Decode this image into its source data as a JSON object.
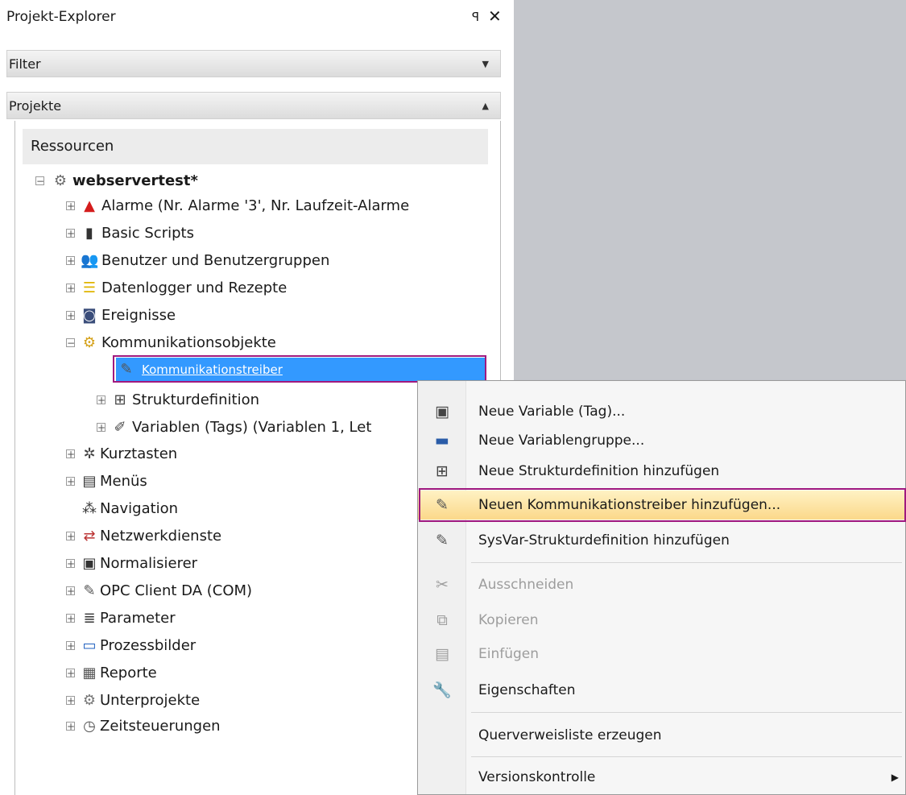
{
  "panel": {
    "title": "Projekt-Explorer",
    "pin_glyph": "ꟼ",
    "close_glyph": "✕",
    "filter_label": "Filter",
    "projects_label": "Projekte",
    "section_label": "Ressourcen"
  },
  "tree": {
    "root": {
      "label": "webservertest*",
      "icon": "gear-icon"
    },
    "items": [
      {
        "label": "Alarme (Nr. Alarme '3', Nr. Laufzeit-Alarme",
        "icon": "alarm-bell-icon"
      },
      {
        "label": "Basic Scripts",
        "icon": "script-icon"
      },
      {
        "label": "Benutzer und Benutzergruppen",
        "icon": "users-icon"
      },
      {
        "label": "Datenlogger und Rezepte",
        "icon": "database-icon"
      },
      {
        "label": "Ereignisse",
        "icon": "event-icon"
      },
      {
        "label": "Kommunikationsobjekte",
        "icon": "gear-icon"
      },
      {
        "label": "Kommunikationstreiber",
        "icon": "driver-icon"
      },
      {
        "label": "Strukturdefinition",
        "icon": "structure-icon"
      },
      {
        "label": "Variablen (Tags) (Variablen 1, Let",
        "icon": "variables-icon"
      },
      {
        "label": "Kurztasten",
        "icon": "shortcut-icon"
      },
      {
        "label": "Menüs",
        "icon": "menu-icon"
      },
      {
        "label": "Navigation",
        "icon": "navigation-icon"
      },
      {
        "label": "Netzwerkdienste",
        "icon": "network-icon"
      },
      {
        "label": "Normalisierer",
        "icon": "normalizer-icon"
      },
      {
        "label": "OPC Client DA (COM)",
        "icon": "opc-icon"
      },
      {
        "label": "Parameter",
        "icon": "parameter-icon"
      },
      {
        "label": "Prozessbilder",
        "icon": "monitor-icon"
      },
      {
        "label": "Reporte",
        "icon": "report-icon"
      },
      {
        "label": "Unterprojekte",
        "icon": "subprojects-icon"
      },
      {
        "label": "Zeitsteuerungen",
        "icon": "clock-icon"
      }
    ]
  },
  "context_menu": {
    "items": [
      {
        "label": "Neue Variable (Tag)...",
        "icon": "new-variable-icon"
      },
      {
        "label": "Neue Variablengruppe...",
        "icon": "new-variable-group-icon"
      },
      {
        "label": "Neue Strukturdefinition hinzufügen",
        "icon": "new-structure-icon"
      },
      {
        "label": "Neuen Kommunikationstreiber hinzufügen...",
        "icon": "new-driver-icon"
      },
      {
        "label": "SysVar-Strukturdefinition hinzufügen",
        "icon": "sysvar-icon"
      },
      {
        "label": "Ausschneiden",
        "icon": "cut-icon"
      },
      {
        "label": "Kopieren",
        "icon": "copy-icon"
      },
      {
        "label": "Einfügen",
        "icon": "paste-icon"
      },
      {
        "label": "Eigenschaften",
        "icon": "wrench-icon"
      },
      {
        "label": "Querverweisliste erzeugen",
        "icon": ""
      },
      {
        "label": "Versionskontrolle",
        "icon": ""
      }
    ]
  },
  "colors": {
    "selection": "#3399ff",
    "highlight_border": "#a0197f",
    "menu_hover": "#fbd88a",
    "workspace": "#c5c7cc"
  }
}
